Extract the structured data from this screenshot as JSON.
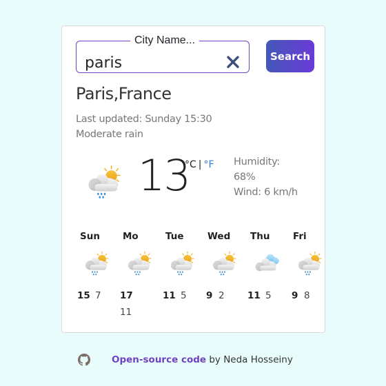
{
  "search": {
    "legend": "City Name...",
    "value": "paris",
    "button_label": "Search",
    "clear_icon": "close-icon"
  },
  "current": {
    "city": "Paris,France",
    "last_updated": "Last updated: Sunday 15:30",
    "condition": "Moderate rain",
    "icon": "sun-cloud-rain-icon",
    "temperature": "13",
    "unit_celsius": "°C",
    "unit_separator": "|",
    "unit_fahrenheit": "°F",
    "humidity_label": "Humidity:",
    "humidity_value": "68%",
    "wind": "Wind: 6 km/h"
  },
  "forecast": [
    {
      "day": "Sun",
      "icon": "sun-cloud-rain-icon",
      "max": "15",
      "min": "7"
    },
    {
      "day": "Mo",
      "icon": "sun-cloud-rain-icon",
      "max": "17",
      "min": "11"
    },
    {
      "day": "Tue",
      "icon": "sun-cloud-rain-icon",
      "max": "11",
      "min": "5"
    },
    {
      "day": "Wed",
      "icon": "sun-cloud-rain-icon",
      "max": "9",
      "min": "2"
    },
    {
      "day": "Thu",
      "icon": "cloudy-icon",
      "max": "11",
      "min": "5"
    },
    {
      "day": "Fri",
      "icon": "sun-cloud-rain-icon",
      "max": "9",
      "min": "8"
    }
  ],
  "footer": {
    "link_text": "Open-source code",
    "suffix": " by Neda Hosseiny",
    "icon": "github-icon"
  },
  "colors": {
    "background": "#e8fcfc",
    "accent": "#6f42c1",
    "fahrenheit_link": "#2f7bd8"
  }
}
